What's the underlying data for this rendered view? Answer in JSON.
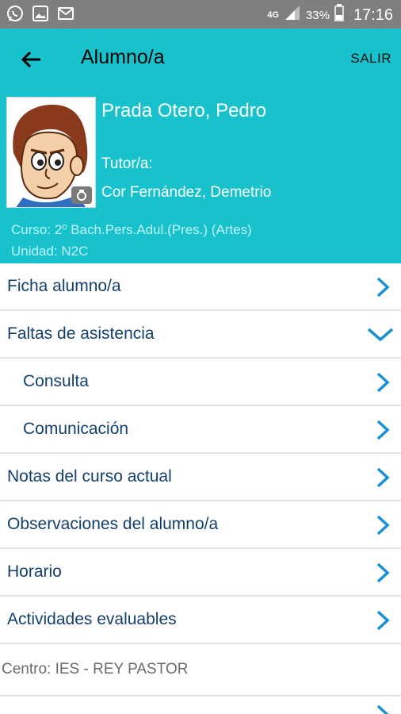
{
  "status_bar": {
    "icons": [
      "whatsapp-icon",
      "gallery-icon",
      "mail-icon"
    ],
    "network": "4G",
    "battery": "33%",
    "time": "17:16"
  },
  "app_bar": {
    "title": "Alumno/a",
    "exit_label": "SALIR"
  },
  "student": {
    "name": "Prada Otero, Pedro",
    "tutor_label": "Tutor/a:",
    "tutor_name": "Cor Fernández, Demetrio",
    "curso": "Curso:  2º Bach.Pers.Adul.(Pres.) (Artes)",
    "unidad": "Unidad: N2C"
  },
  "menu": {
    "ficha": "Ficha alumno/a",
    "faltas": "Faltas de asistencia",
    "consulta": "Consulta",
    "comunicacion": "Comunicación",
    "notas": "Notas del curso actual",
    "observaciones": "Observaciones del alumno/a",
    "horario": "Horario",
    "actividades": "Actividades evaluables"
  },
  "centro": "Centro: IES - REY PASTOR",
  "colors": {
    "accent": "#17c2cd",
    "link_text": "#13406e",
    "chevron": "#1a8fd1"
  }
}
